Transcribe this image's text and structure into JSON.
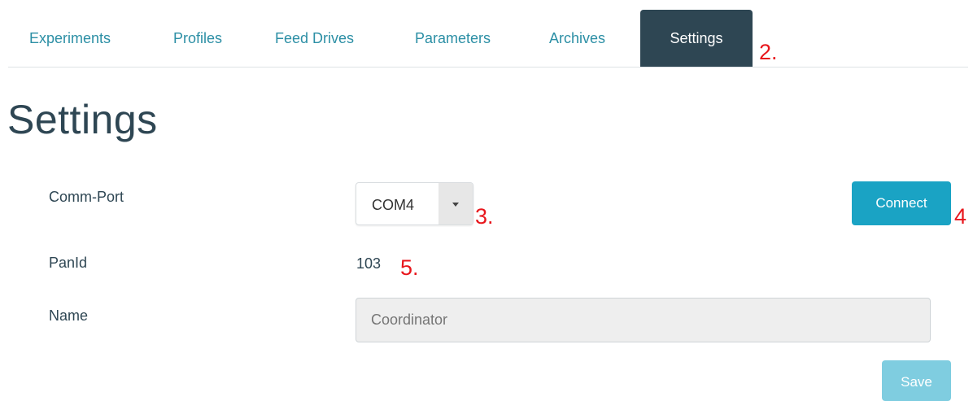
{
  "tabs": [
    {
      "label": "Experiments",
      "active": false
    },
    {
      "label": "Profiles",
      "active": false
    },
    {
      "label": "Feed Drives",
      "active": false
    },
    {
      "label": "Parameters",
      "active": false
    },
    {
      "label": "Archives",
      "active": false
    },
    {
      "label": "Settings",
      "active": true
    }
  ],
  "page_title": "Settings",
  "form": {
    "comm_port": {
      "label": "Comm-Port",
      "selected": "COM4"
    },
    "pan_id": {
      "label": "PanId",
      "value": "103"
    },
    "name": {
      "label": "Name",
      "placeholder": "Coordinator",
      "value": ""
    },
    "connect_label": "Connect",
    "save_label": "Save"
  },
  "annotations": {
    "a2": "2.",
    "a3": "3.",
    "a4": "4",
    "a5": "5."
  },
  "colors": {
    "accent": "#1aa3c4",
    "tab_active_bg": "#2e4653",
    "tab_link": "#2c8fa5",
    "annotation": "#e8161c"
  }
}
